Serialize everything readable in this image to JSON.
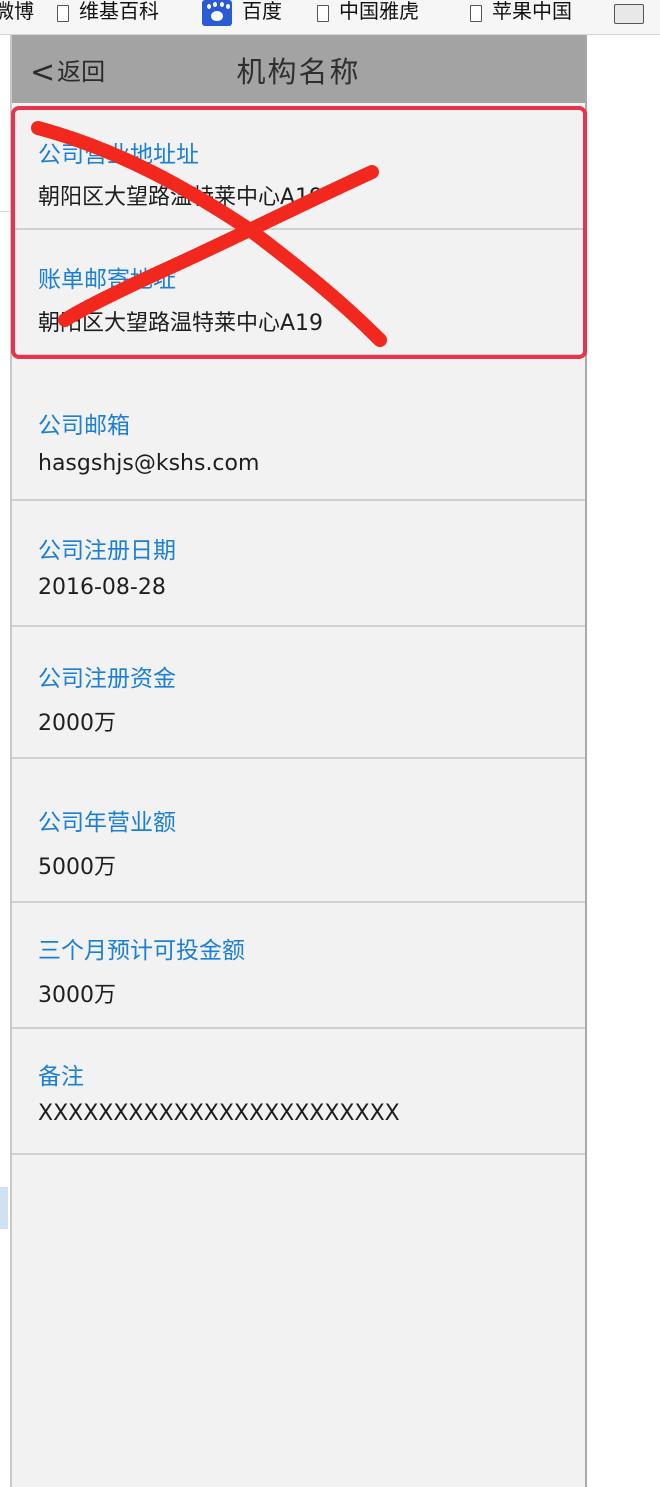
{
  "bookmarks": [
    {
      "label": "微博",
      "icon": "none"
    },
    {
      "label": "维基百科",
      "icon": "page-icon"
    },
    {
      "label": "百度",
      "icon": "baidu-paw-icon"
    },
    {
      "label": "中国雅虎",
      "icon": "page-icon"
    },
    {
      "label": "苹果中国",
      "icon": "page-icon"
    }
  ],
  "header": {
    "back_label": "返回",
    "back_icon": "chevron-left-icon",
    "title": "机构名称"
  },
  "fields": [
    {
      "label": "公司营业地址址",
      "value": "朝阳区大望路温特莱中心A19"
    },
    {
      "label": "账单邮寄地址",
      "value": "朝阳区大望路温特莱中心A19"
    },
    {
      "label": "公司邮箱",
      "value": "hasgshjs@kshs.com"
    },
    {
      "label": "公司注册日期",
      "value": "2016-08-28"
    },
    {
      "label": "公司注册资金",
      "value": "2000万"
    },
    {
      "label": "公司年营业额",
      "value": "5000万"
    },
    {
      "label": "三个月预计可投金额",
      "value": "3000万"
    },
    {
      "label": "备注",
      "value": "XXXXXXXXXXXXXXXXXXXXXXXX"
    }
  ],
  "annotation": {
    "box_color": "#e8344a",
    "cross_color": "#f2281e",
    "cross_icon": "red-x-mark"
  },
  "colors": {
    "label_blue": "#1a7fd6",
    "navbar_gray": "#a3a3a3",
    "background": "#f2f2f2"
  }
}
